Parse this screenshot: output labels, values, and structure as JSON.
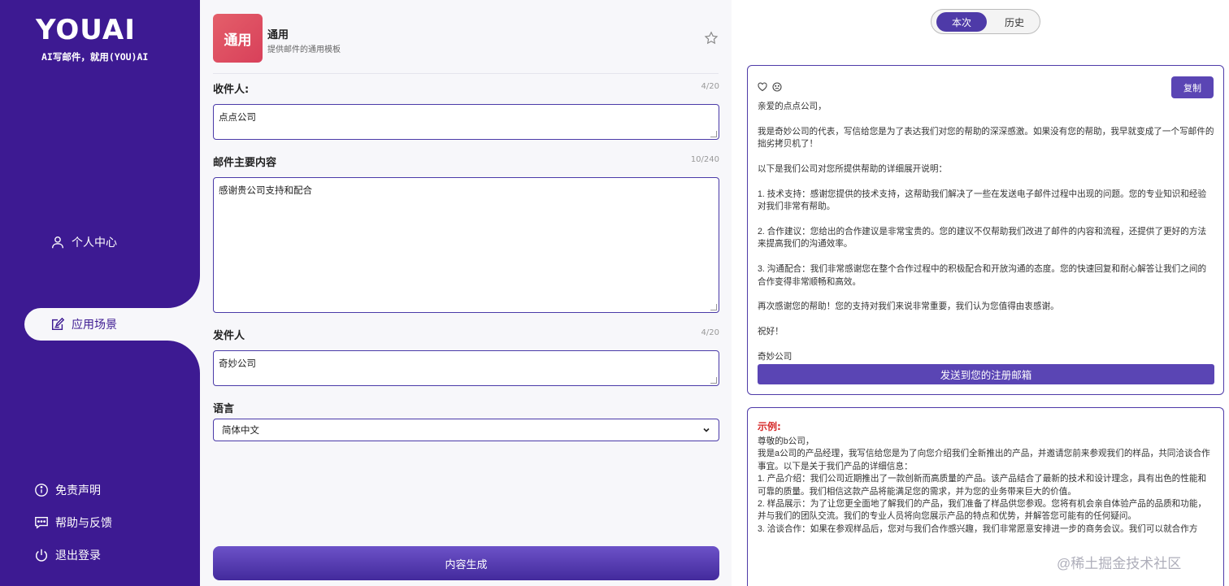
{
  "sidebar": {
    "logo_text": "YOUAI",
    "slogan": "AI写邮件，就用(YOU)AI",
    "nav": [
      {
        "label": "个人中心",
        "icon": "user-icon"
      },
      {
        "label": "应用场景",
        "icon": "edit-icon"
      }
    ],
    "footer": [
      {
        "label": "免责声明",
        "icon": "info-icon"
      },
      {
        "label": "帮助与反馈",
        "icon": "feedback-icon"
      },
      {
        "label": "退出登录",
        "icon": "power-icon"
      }
    ]
  },
  "template": {
    "icon_text": "通用",
    "title": "通用",
    "description": "提供邮件的通用模板"
  },
  "form": {
    "recipient": {
      "label": "收件人:",
      "count": "4/20",
      "value": "点点公司"
    },
    "content": {
      "label": "邮件主要内容",
      "count": "10/240",
      "value": "感谢贵公司支持和配合"
    },
    "sender": {
      "label": "发件人",
      "count": "4/20",
      "value": "奇妙公司"
    },
    "language": {
      "label": "语言",
      "value": "简体中文"
    },
    "generate_label": "内容生成"
  },
  "results": {
    "tabs": {
      "current": "本次",
      "history": "历史"
    },
    "copy_label": "复制",
    "letter": [
      "亲爱的点点公司，",
      "",
      "我是奇妙公司的代表，写信给您是为了表达我们对您的帮助的深深感激。如果没有您的帮助，我早就变成了一个写邮件的拙劣拷贝机了！",
      "",
      "以下是我们公司对您所提供帮助的详细展开说明：",
      "",
      "1. 技术支持：感谢您提供的技术支持，这帮助我们解决了一些在发送电子邮件过程中出现的问题。您的专业知识和经验对我们非常有帮助。",
      "",
      "2. 合作建议：您给出的合作建议是非常宝贵的。您的建议不仅帮助我们改进了邮件的内容和流程，还提供了更好的方法来提高我们的沟通效率。",
      "",
      "3. 沟通配合：我们非常感谢您在整个合作过程中的积极配合和开放沟通的态度。您的快速回复和耐心解答让我们之间的合作变得非常顺畅和高效。",
      "",
      "再次感谢您的帮助！您的支持对我们来说非常重要，我们认为您值得由衷感谢。",
      "",
      "祝好！",
      "",
      "奇妙公司"
    ],
    "send_label": "发送到您的注册邮箱",
    "example_tag": "示例:",
    "example": [
      "尊敬的b公司，",
      "",
      "我是a公司的产品经理，我写信给您是为了向您介绍我们全新推出的产品，并邀请您前来参观我们的样品，共同洽谈合作事宜。以下是关于我们产品的详细信息：",
      "",
      "1. 产品介绍：我们公司近期推出了一款创新而高质量的产品。该产品结合了最新的技术和设计理念，具有出色的性能和可靠的质量。我们相信这款产品将能满足您的需求，并为您的业务带来巨大的价值。",
      "",
      "2. 样品展示：为了让您更全面地了解我们的产品，我们准备了样品供您参观。您将有机会亲自体验产品的品质和功能，并与我们的团队交流。我们的专业人员将向您展示产品的特点和优势，并解答您可能有的任何疑问。",
      "",
      "3. 洽谈合作：如果在参观样品后，您对与我们合作感兴趣，我们非常愿意安排进一步的商务会议。我们可以就合作方"
    ],
    "watermark": "@稀土掘金技术社区"
  },
  "colors": {
    "sidebar": "#3d1a92",
    "accent": "#5a45b4",
    "example_tag": "#d62a2a"
  }
}
